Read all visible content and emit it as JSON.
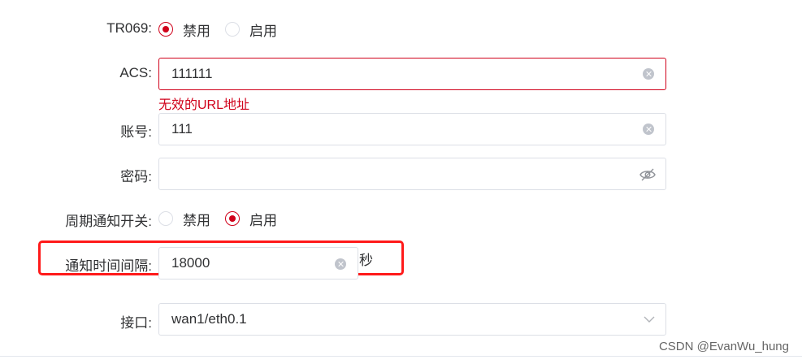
{
  "tr069": {
    "label": "TR069:",
    "options": [
      {
        "text": "禁用",
        "checked": true
      },
      {
        "text": "启用",
        "checked": false
      }
    ]
  },
  "acs": {
    "label": "ACS:",
    "value": "111111",
    "error": "无效的URL地址"
  },
  "account": {
    "label": "账号:",
    "value": "111"
  },
  "password": {
    "label": "密码:",
    "value": ""
  },
  "periodic": {
    "label": "周期通知开关:",
    "options": [
      {
        "text": "禁用",
        "checked": false
      },
      {
        "text": "启用",
        "checked": true
      }
    ]
  },
  "interval": {
    "label": "通知时间间隔:",
    "value": "18000",
    "unit": "秒"
  },
  "interface": {
    "label": "接口:",
    "value": "wan1/eth0.1"
  },
  "watermark": "CSDN @EvanWu_hung",
  "colors": {
    "accent": "#d0021b",
    "highlight": "#ff1a1a",
    "border": "#dcdfe6"
  }
}
